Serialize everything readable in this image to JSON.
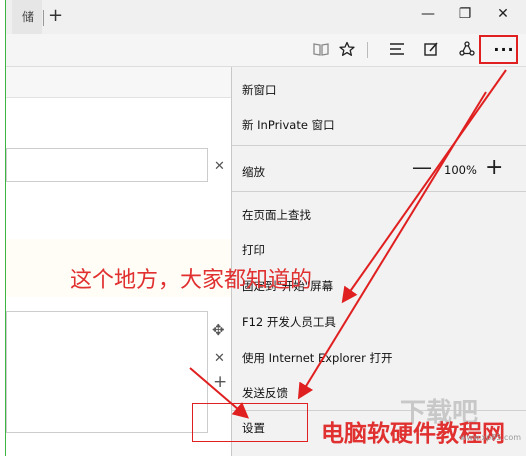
{
  "browser": {
    "tab_partial_label": "储",
    "new_tab_symbol": "+",
    "window_controls": {
      "minimize": "—",
      "restore": "❐",
      "close": "✕"
    },
    "toolbar_icons": [
      "reading-view-icon",
      "favorite-star-icon",
      "hub-icon",
      "web-note-icon",
      "share-icon",
      "more-icon"
    ],
    "more_label": "···"
  },
  "page": {
    "clear_symbol": "✕",
    "move_symbol": "✥",
    "add_symbol": "+"
  },
  "menu": {
    "new_window": "新窗口",
    "new_inprivate": "新 InPrivate 窗口",
    "zoom_label": "缩放",
    "zoom_minus": "—",
    "zoom_value": "100%",
    "zoom_plus": "+",
    "find": "在页面上查找",
    "print": "打印",
    "pin_start": "固定到\"开始\"屏幕",
    "devtools": "F12 开发人员工具",
    "open_ie": "使用 Internet Explorer 打开",
    "feedback": "发送反馈",
    "settings": "设置"
  },
  "annotation": {
    "caption": "这个地方，大家都知道的",
    "accent_color": "#e02020"
  },
  "watermark": {
    "text": "电脑软硬件教程网",
    "ghost": "下载吧",
    "url": "www.xp85.com"
  }
}
